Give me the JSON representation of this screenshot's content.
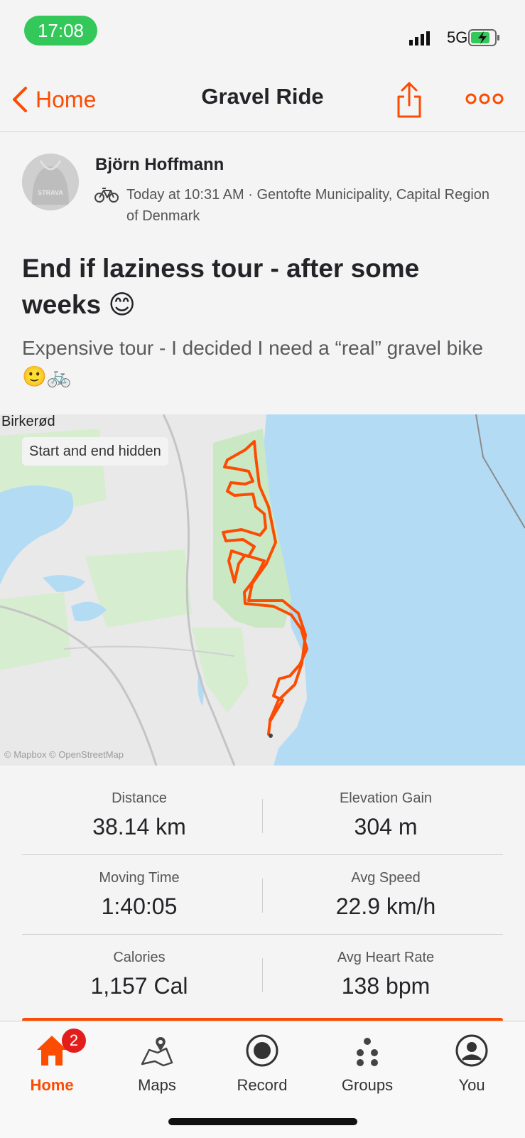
{
  "status_bar": {
    "time": "17:08",
    "network": "5G"
  },
  "nav": {
    "back_label": "Home",
    "title": "Gravel Ride"
  },
  "activity": {
    "athlete_name": "Björn Hoffmann",
    "avatar_text": "STRAVA",
    "meta": "Today at 10:31 AM · Gentofte Municipality, Capital Region of Denmark",
    "title": "End if laziness tour - after some weeks 😊",
    "description": "Expensive tour - I decided I need a “real” gravel bike 🙂🚲"
  },
  "map": {
    "city_label": "Birkerød",
    "privacy_chip": "Start and end hidden",
    "attribution": "© Mapbox © OpenStreetMap",
    "route_color": "#fc4c02"
  },
  "stats": [
    {
      "label": "Distance",
      "value": "38.14 km"
    },
    {
      "label": "Elevation Gain",
      "value": "304 m"
    },
    {
      "label": "Moving Time",
      "value": "1:40:05"
    },
    {
      "label": "Avg Speed",
      "value": "22.9 km/h"
    },
    {
      "label": "Calories",
      "value": "1,157 Cal"
    },
    {
      "label": "Avg Heart Rate",
      "value": "138 bpm"
    }
  ],
  "tabs": [
    {
      "label": "Home",
      "icon": "home-icon",
      "active": true,
      "badge": "2"
    },
    {
      "label": "Maps",
      "icon": "maps-icon"
    },
    {
      "label": "Record",
      "icon": "record-icon"
    },
    {
      "label": "Groups",
      "icon": "groups-icon"
    },
    {
      "label": "You",
      "icon": "profile-icon"
    }
  ],
  "colors": {
    "accent": "#fc4c02",
    "badge": "#e31c1c",
    "status_green": "#34c759",
    "water": "#b3dcf4",
    "park": "#cbe8c4"
  }
}
